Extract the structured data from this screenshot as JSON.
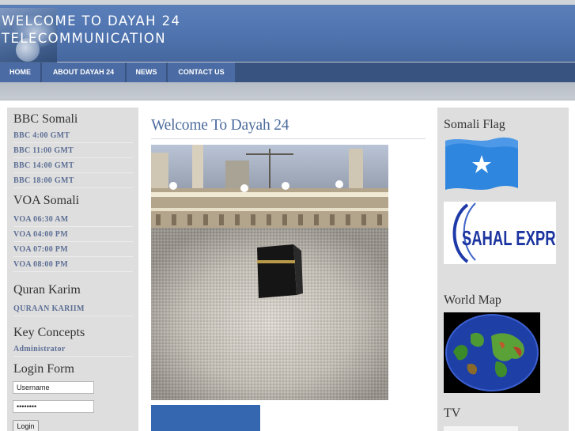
{
  "header": {
    "title": "WELCOME TO DAYAH 24\nTELECOMMUNICATION"
  },
  "nav": {
    "items": [
      "HOME",
      "ABOUT DAYAH 24",
      "NEWS",
      "CONTACT US"
    ]
  },
  "left_sidebar": {
    "bbc": {
      "title": "BBC Somali",
      "links": [
        "BBC 4:00 GMT",
        "BBC 11:00 GMT",
        "BBC 14:00 GMT",
        "BBC 18:00 GMT"
      ]
    },
    "voa": {
      "title": "VOA Somali",
      "links": [
        "VOA 06:30 AM",
        "VOA 04:00 PM",
        "VOA 07:00 PM",
        "VOA 08:00 PM"
      ]
    },
    "quran": {
      "title": "Quran Karim",
      "links": [
        "QURAAN KARIIM"
      ]
    },
    "key_concepts": {
      "title": "Key Concepts",
      "links": [
        "Administrator"
      ]
    },
    "login": {
      "title": "Login Form",
      "username_value": "Username",
      "password_value": "••••••••",
      "button_label": "Login"
    }
  },
  "main": {
    "title": "Welcome To Dayah 24"
  },
  "right_sidebar": {
    "flag_title": "Somali Flag",
    "sahal_text": "SAHAL EXPRESS",
    "map_title": "World Map",
    "tv_title": "TV"
  },
  "colors": {
    "header_blue": "#4f73ae",
    "nav_blue": "#4a6ba3",
    "title_blue": "#4c6b9d",
    "link_color": "#5d6f95"
  }
}
